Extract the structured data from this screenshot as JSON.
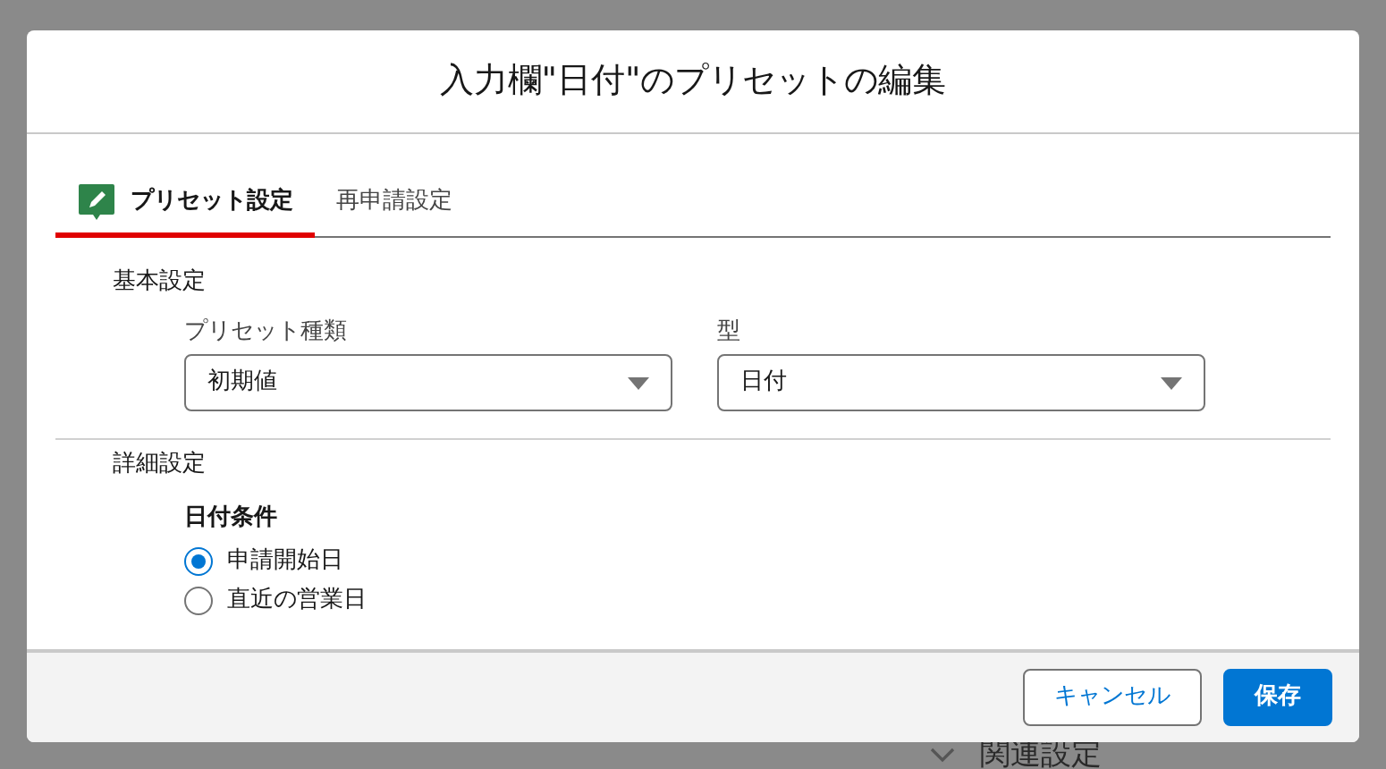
{
  "backdrop": {
    "section_title": "関連設定"
  },
  "modal": {
    "title": "入力欄\"日付\"のプリセットの編集",
    "tabs": [
      {
        "label": "プリセット設定",
        "selected": true
      },
      {
        "label": "再申請設定",
        "selected": false
      }
    ],
    "basic": {
      "heading": "基本設定",
      "fields": [
        {
          "label": "プリセット種類",
          "value": "初期値"
        },
        {
          "label": "型",
          "value": "日付"
        }
      ]
    },
    "detail": {
      "heading": "詳細設定",
      "group_label": "日付条件",
      "options": [
        {
          "label": "申請開始日",
          "selected": true
        },
        {
          "label": "直近の営業日",
          "selected": false
        }
      ]
    },
    "buttons": [
      {
        "label": "キャンセル",
        "kind": "neutral"
      },
      {
        "label": "保存",
        "kind": "brand"
      }
    ]
  }
}
